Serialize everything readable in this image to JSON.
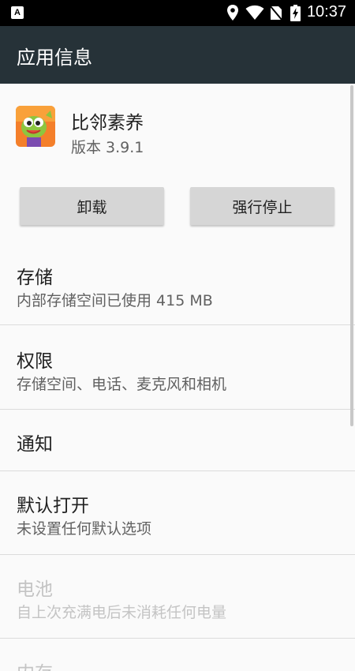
{
  "status_bar": {
    "notification_icon": "A",
    "time": "10:37",
    "icons": [
      "location-icon",
      "wifi-icon",
      "no-sim-icon",
      "battery-charging-icon"
    ]
  },
  "app_bar": {
    "title": "应用信息"
  },
  "app": {
    "name": "比邻素养",
    "version": "版本 3.9.1"
  },
  "buttons": {
    "uninstall": "卸载",
    "force_stop": "强行停止"
  },
  "items": [
    {
      "title": "存储",
      "summary": "内部存储空间已使用 415 MB",
      "enabled": true
    },
    {
      "title": "权限",
      "summary": "存储空间、电话、麦克风和相机",
      "enabled": true
    },
    {
      "title": "通知",
      "summary": "",
      "enabled": true
    },
    {
      "title": "默认打开",
      "summary": "未设置任何默认选项",
      "enabled": true
    },
    {
      "title": "电池",
      "summary": "自上次充满电后未消耗任何电量",
      "enabled": false
    },
    {
      "title": "内存",
      "summary": "",
      "enabled": false
    }
  ],
  "colors": {
    "app_bar": "#263238",
    "status_bar": "#000000",
    "background": "#fafafa",
    "button": "#d6d6d6",
    "disabled_text": "#c4c4c4"
  }
}
